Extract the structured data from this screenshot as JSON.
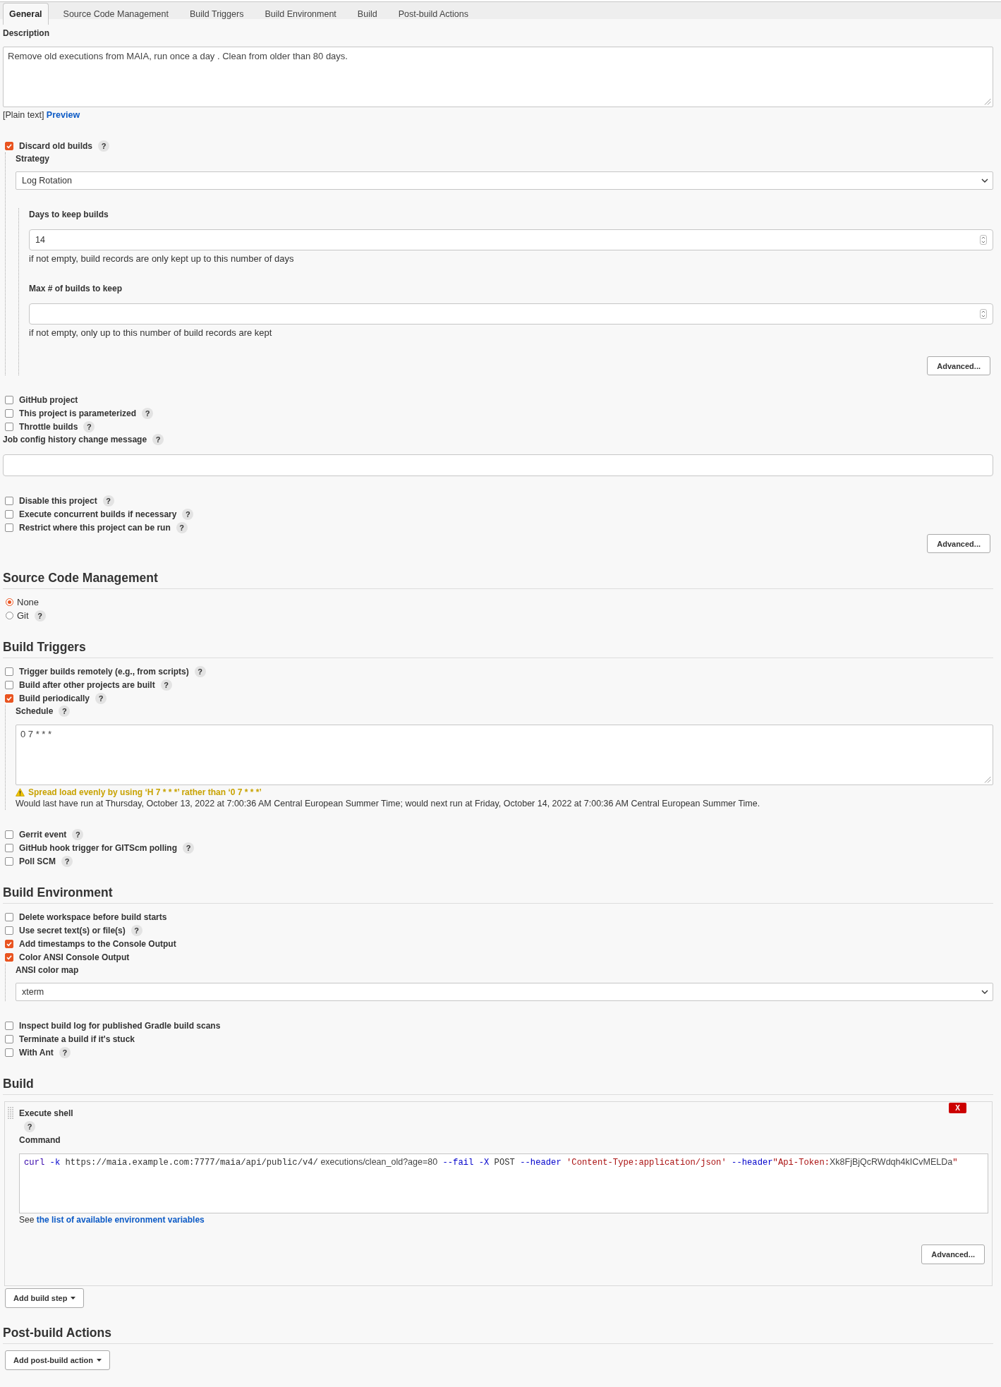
{
  "tabs": [
    {
      "label": "General",
      "selected": true
    },
    {
      "label": "Source Code Management",
      "selected": false
    },
    {
      "label": "Build Triggers",
      "selected": false
    },
    {
      "label": "Build Environment",
      "selected": false
    },
    {
      "label": "Build",
      "selected": false
    },
    {
      "label": "Post-build Actions",
      "selected": false
    }
  ],
  "sections": [
    {
      "items": [
        {
          "kind": "textarea",
          "label": "Description",
          "value": "Remove old executions from MAIA, run once a day . Clean from older than 80 days.",
          "format": "[Plain text]",
          "format_link": "Preview"
        },
        {
          "kind": "checkbox",
          "label": "Discard old builds",
          "checked": true,
          "help": "?",
          "children": [
            {
              "kind": "select",
              "label": "Strategy",
              "value": "Log Rotation",
              "children": [
                {
                  "kind": "number",
                  "label": "Days to keep builds",
                  "value": "14",
                  "hint": "if not empty, build records are only kept up to this number of days"
                },
                {
                  "kind": "number",
                  "label": "Max # of builds to keep",
                  "hint": "if not empty, only up to this number of build records are kept"
                },
                {
                  "kind": "button",
                  "label": "Advanced..."
                }
              ]
            }
          ]
        },
        {
          "kind": "checkbox",
          "label": "GitHub project",
          "checked": false
        },
        {
          "kind": "checkbox",
          "label": "This project is parameterized",
          "checked": false,
          "help": "?"
        },
        {
          "kind": "checkbox",
          "label": "Throttle builds",
          "checked": false,
          "help": "?"
        },
        {
          "kind": "text",
          "label": "Job config history change message",
          "help": "?"
        },
        {
          "kind": "checkbox",
          "label": "Disable this project",
          "checked": false,
          "help": "?"
        },
        {
          "kind": "checkbox",
          "label": "Execute concurrent builds if necessary",
          "checked": false,
          "help": "?"
        },
        {
          "kind": "checkbox",
          "label": "Restrict where this project can be run",
          "checked": false,
          "help": "?"
        },
        {
          "kind": "button",
          "label": "Advanced..."
        }
      ]
    },
    {
      "heading": "Source Code Management",
      "items": [
        {
          "kind": "radio",
          "label": "None",
          "selected": true
        },
        {
          "kind": "radio",
          "label": "Git",
          "selected": false,
          "help": "?"
        }
      ]
    },
    {
      "heading": "Build Triggers",
      "items": [
        {
          "kind": "checkbox",
          "label": "Trigger builds remotely (e.g., from scripts)",
          "checked": false,
          "help": "?"
        },
        {
          "kind": "checkbox",
          "label": "Build after other projects are built",
          "checked": false,
          "help": "?"
        },
        {
          "kind": "checkbox",
          "label": "Build periodically",
          "checked": true,
          "help": "?",
          "children": [
            {
              "kind": "textarea",
              "label": "Schedule",
              "help": "?",
              "value": "0 7 * * *",
              "warning": "Spread load evenly by using ‘H 7 * * *’ rather than ‘0 7 * * *’",
              "note": "Would last have run at Thursday, October 13, 2022 at 7:00:36 AM Central European Summer Time; would next run at Friday, October 14, 2022 at 7:00:36 AM Central European Summer Time."
            }
          ]
        },
        {
          "kind": "checkbox",
          "label": "Gerrit event",
          "checked": false,
          "help": "?"
        },
        {
          "kind": "checkbox",
          "label": "GitHub hook trigger for GITScm polling",
          "checked": false,
          "help": "?"
        },
        {
          "kind": "checkbox",
          "label": "Poll SCM",
          "checked": false,
          "help": "?"
        }
      ]
    },
    {
      "heading": "Build Environment",
      "items": [
        {
          "kind": "checkbox",
          "label": "Delete workspace before build starts",
          "checked": false
        },
        {
          "kind": "checkbox",
          "label": "Use secret text(s) or file(s)",
          "checked": false,
          "help": "?"
        },
        {
          "kind": "checkbox",
          "label": "Add timestamps to the Console Output",
          "checked": true
        },
        {
          "kind": "checkbox",
          "label": "Color ANSI Console Output",
          "checked": true,
          "children": [
            {
              "kind": "select",
              "label": "ANSI color map",
              "value": "xterm"
            }
          ]
        },
        {
          "kind": "checkbox",
          "label": "Inspect build log for published Gradle build scans",
          "checked": false
        },
        {
          "kind": "checkbox",
          "label": "Terminate a build if it's stuck",
          "checked": false
        },
        {
          "kind": "checkbox",
          "label": "With Ant",
          "checked": false,
          "help": "?"
        }
      ]
    },
    {
      "heading": "Build",
      "items": [
        {
          "kind": "build-step",
          "title": "Execute shell",
          "delete": "X",
          "help": "?",
          "command_label": "Command",
          "command": [
            {
              "kind": "builtin",
              "text": "curl"
            },
            {
              "kind": "attribute",
              "text": " -k"
            },
            {
              "kind": "plain",
              "text": " https://maia.example.com:7777/maia/api/public/v4/"
            },
            {
              "kind": "plain-sans",
              "text": " executions/clean_old?age=80"
            },
            {
              "kind": "attribute",
              "text": " --fail"
            },
            {
              "kind": "attribute",
              "text": " -X"
            },
            {
              "kind": "plain",
              "text": " POST"
            },
            {
              "kind": "attribute",
              "text": " --header"
            },
            {
              "kind": "string",
              "text": " 'Content-Type:application/json'"
            },
            {
              "kind": "attribute",
              "text": " --header"
            },
            {
              "kind": "string",
              "text": "\"Api-Token:"
            },
            {
              "kind": "plain-sans",
              "text": "Xk8FjBjQcRWdqh4kICvMELDa"
            },
            {
              "kind": "string",
              "text": "\""
            }
          ],
          "note": "See",
          "note_link": "the list of available environment variables",
          "advanced": "Advanced..."
        },
        {
          "kind": "menu-button",
          "label": "Add build step"
        }
      ]
    },
    {
      "heading": "Post-build Actions",
      "items": [
        {
          "kind": "menu-button",
          "label": "Add post-build action"
        }
      ]
    }
  ]
}
